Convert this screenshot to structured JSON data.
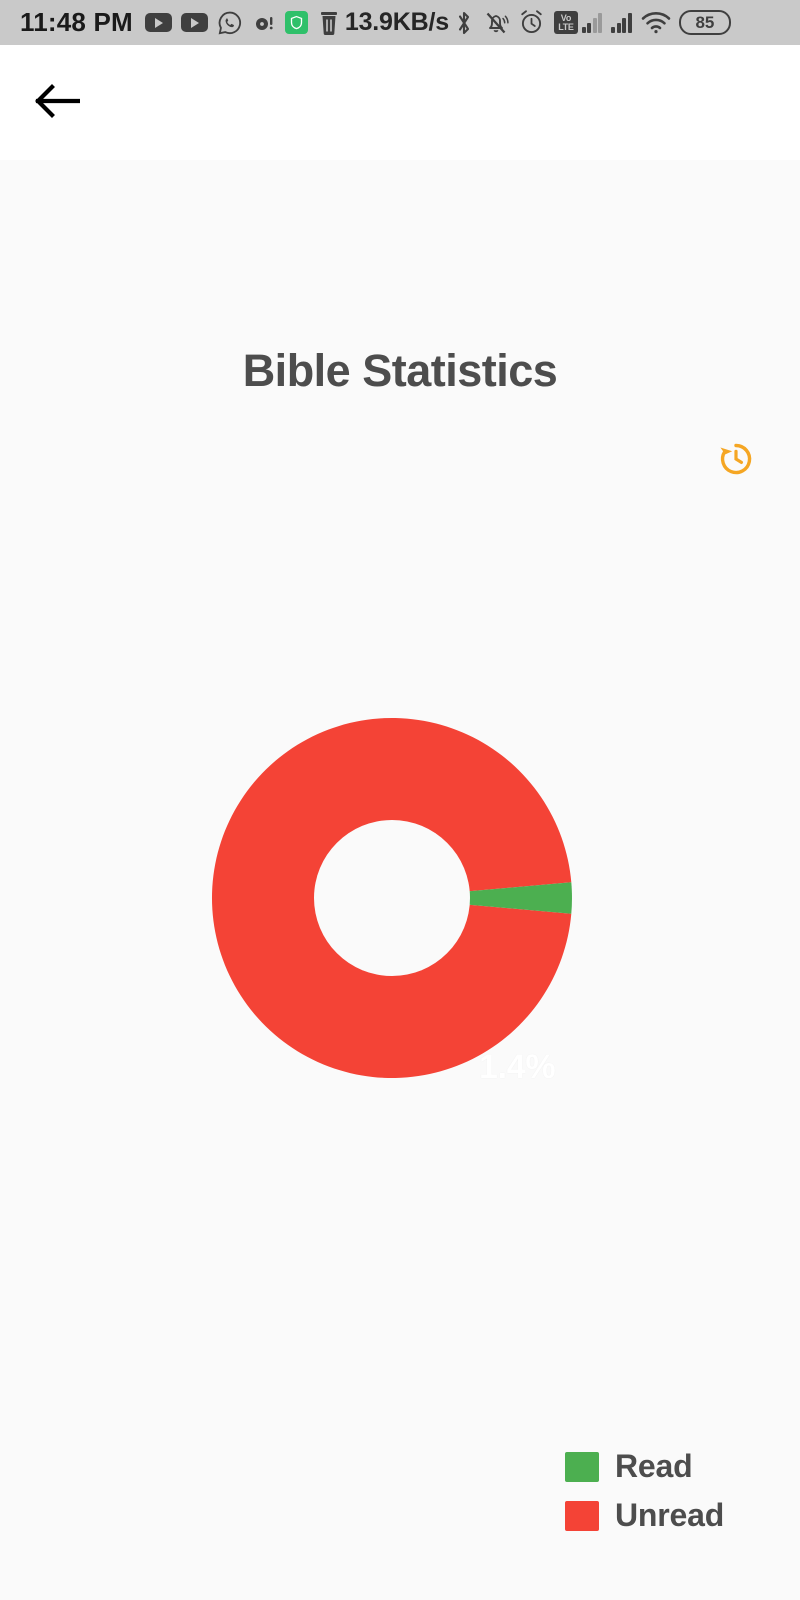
{
  "status_bar": {
    "time": "11:48 PM",
    "network_speed": "13.9KB/s",
    "battery_level": "85",
    "volte_top": "Vo",
    "volte_bottom": "LTE",
    "icons": [
      "youtube-icon",
      "youtube-icon",
      "whatsapp-icon",
      "voice-recorder-alert-icon",
      "mi-security-icon",
      "trash-icon",
      "bluetooth-icon",
      "bell-muted-icon",
      "alarm-clock-icon",
      "volte-icon",
      "signal-bars-sim1-icon",
      "signal-bars-sim2-icon",
      "wifi-icon",
      "battery-icon"
    ],
    "background_color": "#c9c9c9",
    "foreground_color": "#333333"
  },
  "app_bar": {
    "back_icon": "arrow-left-icon",
    "background_color": "#ffffff"
  },
  "main": {
    "title": "Bible Statistics",
    "title_color": "#4d4d4d",
    "background_color": "#fafafa",
    "history_icon": "history-clock-icon",
    "history_icon_color": "#f5a623"
  },
  "chart_data": {
    "type": "pie",
    "variant": "donut",
    "title": "Bible Statistics",
    "labels": [
      "Read",
      "Unread"
    ],
    "values": [
      1.4,
      98.6
    ],
    "value_unit": "%",
    "data_labels": [
      "1.4%",
      ""
    ],
    "colors": [
      "#4caf50",
      "#f44336"
    ],
    "legend": [
      {
        "label": "Read",
        "color": "#4caf50"
      },
      {
        "label": "Unread",
        "color": "#f44336"
      }
    ],
    "legend_position": "bottom-right",
    "hole_ratio": 0.43,
    "hole_color": "#fafafa",
    "start_angle_deg": -5,
    "label_text_color": "#ffffff",
    "grid": false
  },
  "legend": {
    "read_label": "Read",
    "unread_label": "Unread",
    "read_color": "#4caf50",
    "unread_color": "#f44336"
  }
}
